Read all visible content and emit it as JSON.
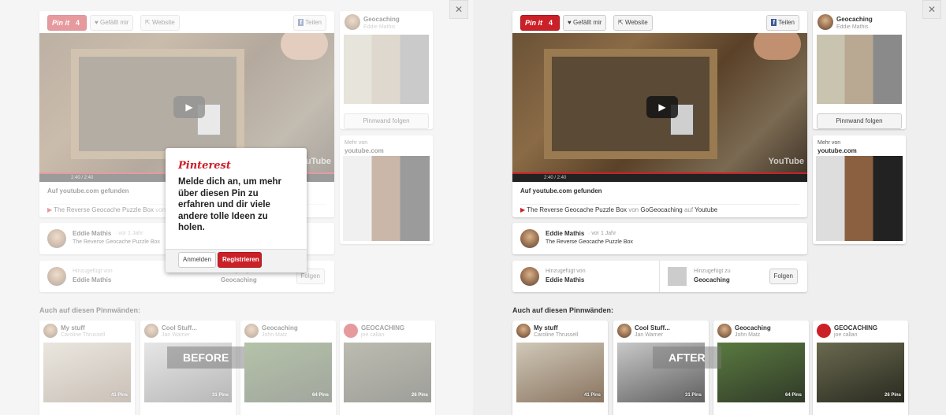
{
  "pin_toolbar": {
    "pin_it_label": "Pin it",
    "pin_count": "4",
    "like_label": "Gefällt mir",
    "website_label": "Website",
    "share_label": "Teilen"
  },
  "video": {
    "time": "2:40 / 2:40",
    "play_icon": "play-icon",
    "logo": "YouTube"
  },
  "source": {
    "found_on": "Auf youtube.com gefunden",
    "title": "The Reverse Geocache Puzzle Box",
    "by_word": "von",
    "uploader": "GoGeocaching",
    "on_word": "auf",
    "site": "Youtube"
  },
  "pinner": {
    "name": "Eddie Mathis",
    "time": "· vor 1 Jahr",
    "description": "The Reverse Geocache Puzzle Box"
  },
  "added": {
    "by_label": "Hinzugefügt von",
    "by_name": "Eddie Mathis",
    "to_label": "Hinzugefügt zu",
    "to_name": "Geocaching",
    "follow_label": "Folgen"
  },
  "board_sidebar": {
    "title": "Geocaching",
    "owner": "Eddie Mathis",
    "follow_board": "Pinnwand folgen"
  },
  "more_from": {
    "label": "Mehr von",
    "site": "youtube.com"
  },
  "also_on_title": "Auch auf diesen Pinnwänden:",
  "boards": [
    {
      "title": "My stuff",
      "owner": "Caroline Thrussell",
      "pins": "41 Pins"
    },
    {
      "title": "Cool Stuff...",
      "owner": "Jan Warner",
      "pins": "31 Pins"
    },
    {
      "title": "Geocaching",
      "owner": "John Matz",
      "pins": "64 Pins"
    },
    {
      "title": "GEOCACHING",
      "owner": "joe callan",
      "pins": "26 Pins"
    }
  ],
  "modal": {
    "logo": "Pinterest",
    "message": "Melde dich an, um mehr über diesen Pin zu erfahren und dir viele andere tolle Ideen zu holen.",
    "login_label": "Anmelden",
    "register_label": "Registrieren"
  },
  "labels": {
    "before": "BEFORE",
    "after": "AFTER"
  },
  "close_glyph": "✕"
}
